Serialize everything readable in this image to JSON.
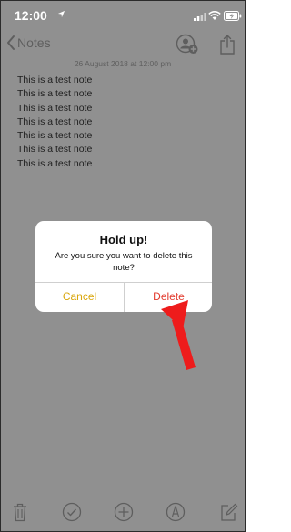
{
  "status_bar": {
    "time": "12:00",
    "icons": [
      "location-icon",
      "signal-icon",
      "wifi-icon",
      "battery-icon"
    ]
  },
  "nav": {
    "back_label": "Notes",
    "icons": [
      "chevron-left-icon",
      "add-person-icon",
      "share-icon"
    ]
  },
  "note": {
    "date": "26 August 2018 at 12:00 pm",
    "lines": [
      "This is a test note",
      "This is a test note",
      "This is a test note",
      "This is a test note",
      "This is a test note",
      "This is a test note",
      "This is a test note"
    ]
  },
  "dialog": {
    "title": "Hold up!",
    "message": "Are you sure you want to delete this note?",
    "cancel_label": "Cancel",
    "delete_label": "Delete"
  },
  "toolbar": {
    "icons": [
      "trash-icon",
      "checklist-icon",
      "add-icon",
      "sketch-icon",
      "compose-icon"
    ]
  },
  "colors": {
    "overlay_bg": "#909090",
    "cancel": "#d9a60a",
    "delete": "#e23a2d",
    "arrow": "#ee1c1c"
  }
}
